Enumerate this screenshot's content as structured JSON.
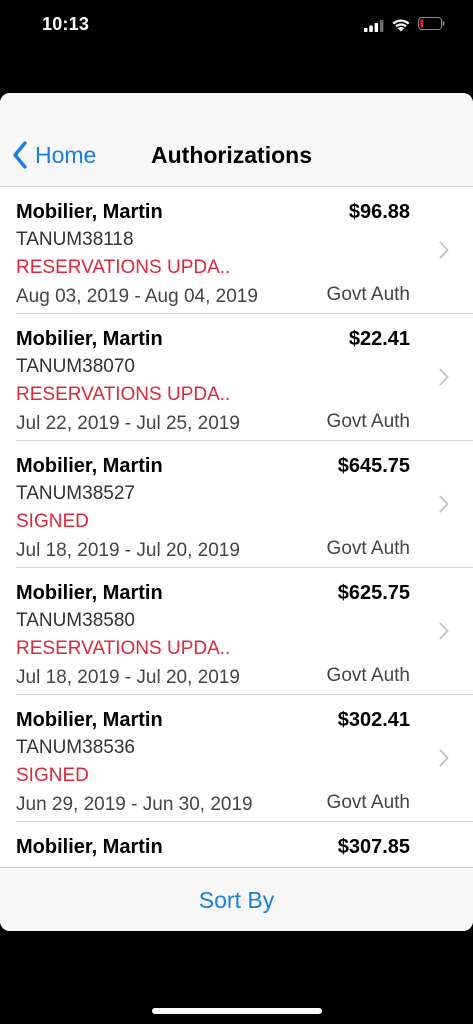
{
  "status_bar": {
    "time": "10:13"
  },
  "nav": {
    "back_label": "Home",
    "title": "Authorizations"
  },
  "rows": [
    {
      "name": "Mobilier, Martin",
      "amount": "$96.88",
      "id": "TANUM38118",
      "status": "RESERVATIONS UPDA..",
      "dates": "Aug 03, 2019 - Aug 04, 2019",
      "type": "Govt Auth"
    },
    {
      "name": "Mobilier, Martin",
      "amount": "$22.41",
      "id": "TANUM38070",
      "status": "RESERVATIONS UPDA..",
      "dates": "Jul 22, 2019 - Jul 25, 2019",
      "type": "Govt Auth"
    },
    {
      "name": "Mobilier, Martin",
      "amount": "$645.75",
      "id": "TANUM38527",
      "status": "SIGNED",
      "dates": "Jul 18, 2019 - Jul 20, 2019",
      "type": "Govt Auth"
    },
    {
      "name": "Mobilier, Martin",
      "amount": "$625.75",
      "id": "TANUM38580",
      "status": "RESERVATIONS UPDA..",
      "dates": "Jul 18, 2019 - Jul 20, 2019",
      "type": "Govt Auth"
    },
    {
      "name": "Mobilier, Martin",
      "amount": "$302.41",
      "id": "TANUM38536",
      "status": "SIGNED",
      "dates": "Jun 29, 2019 - Jun 30, 2019",
      "type": "Govt Auth"
    },
    {
      "name": "Mobilier, Martin",
      "amount": "$307.85",
      "id": "",
      "status": "",
      "dates": "",
      "type": ""
    }
  ],
  "bottom_bar": {
    "sort_label": "Sort By"
  },
  "colors": {
    "accent": "#1a7fdc",
    "status_red": "#e0263a"
  },
  "icons": {
    "back": "chevron-left-icon",
    "row_disclosure": "chevron-right-icon",
    "signal": "cellular-signal-icon",
    "wifi": "wifi-icon",
    "battery": "battery-low-icon"
  }
}
